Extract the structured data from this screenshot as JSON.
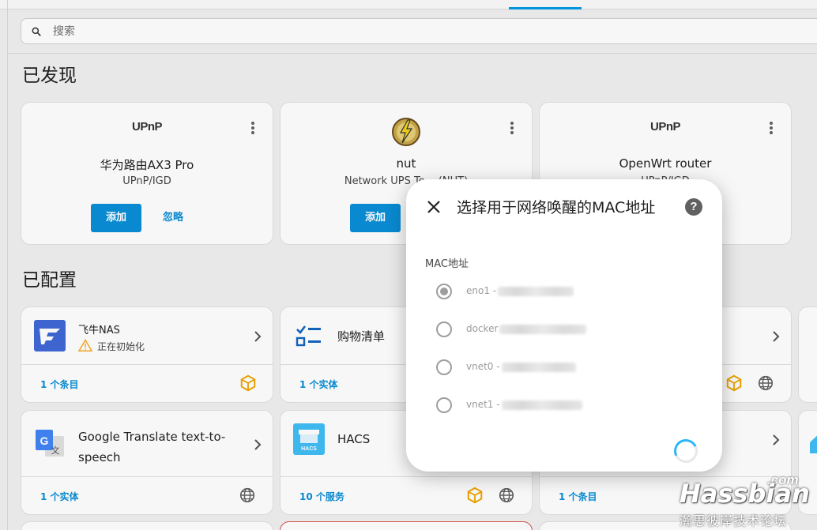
{
  "search": {
    "placeholder": "搜索"
  },
  "discovered": {
    "title": "已发现",
    "cards": [
      {
        "logo": "UPnP",
        "title": "华为路由AX3 Pro",
        "subtitle": "UPnP/IGD",
        "add_label": "添加",
        "ignore_label": "忽略"
      },
      {
        "logo": "nut-logo",
        "title": "nut",
        "subtitle": "Network UPS To… (NUT)",
        "add_label": "添加"
      },
      {
        "logo": "UPnP",
        "title": "OpenWrt router",
        "subtitle": "UPnP/IGD"
      }
    ]
  },
  "configured": {
    "title": "已配置",
    "cards": [
      {
        "name": "飞牛NAS",
        "status": "正在初始化",
        "footer": "1 个条目",
        "icon": "fnos-icon"
      },
      {
        "name": "购物清单",
        "footer": "1 个实体",
        "icon": "checklist-icon"
      },
      {
        "footer": "",
        "icon": ""
      },
      {
        "name": "Google Translate text-to-speech",
        "footer": "1 个实体",
        "icon": "google-translate-icon"
      },
      {
        "name": "HACS",
        "footer": "10 个服务",
        "icon": "hacs-icon"
      },
      {
        "footer": "1 个条目",
        "icon": ""
      }
    ]
  },
  "dialog": {
    "title": "选择用于网络唤醒的MAC地址",
    "field_label": "MAC地址",
    "options": [
      {
        "label": "eno1 -",
        "selected": true
      },
      {
        "label": "docker",
        "selected": false
      },
      {
        "label": "vnet0 -",
        "selected": false
      },
      {
        "label": "vnet1 -",
        "selected": false
      }
    ],
    "help": "?"
  },
  "watermark": {
    "brand": "Hassbian",
    "domain": ".com",
    "subtitle": "瀚思彼岸技术论坛"
  },
  "colors": {
    "accent": "#0a8ed6",
    "warning": "#f9a825",
    "hacs_blue": "#41bdf5"
  }
}
